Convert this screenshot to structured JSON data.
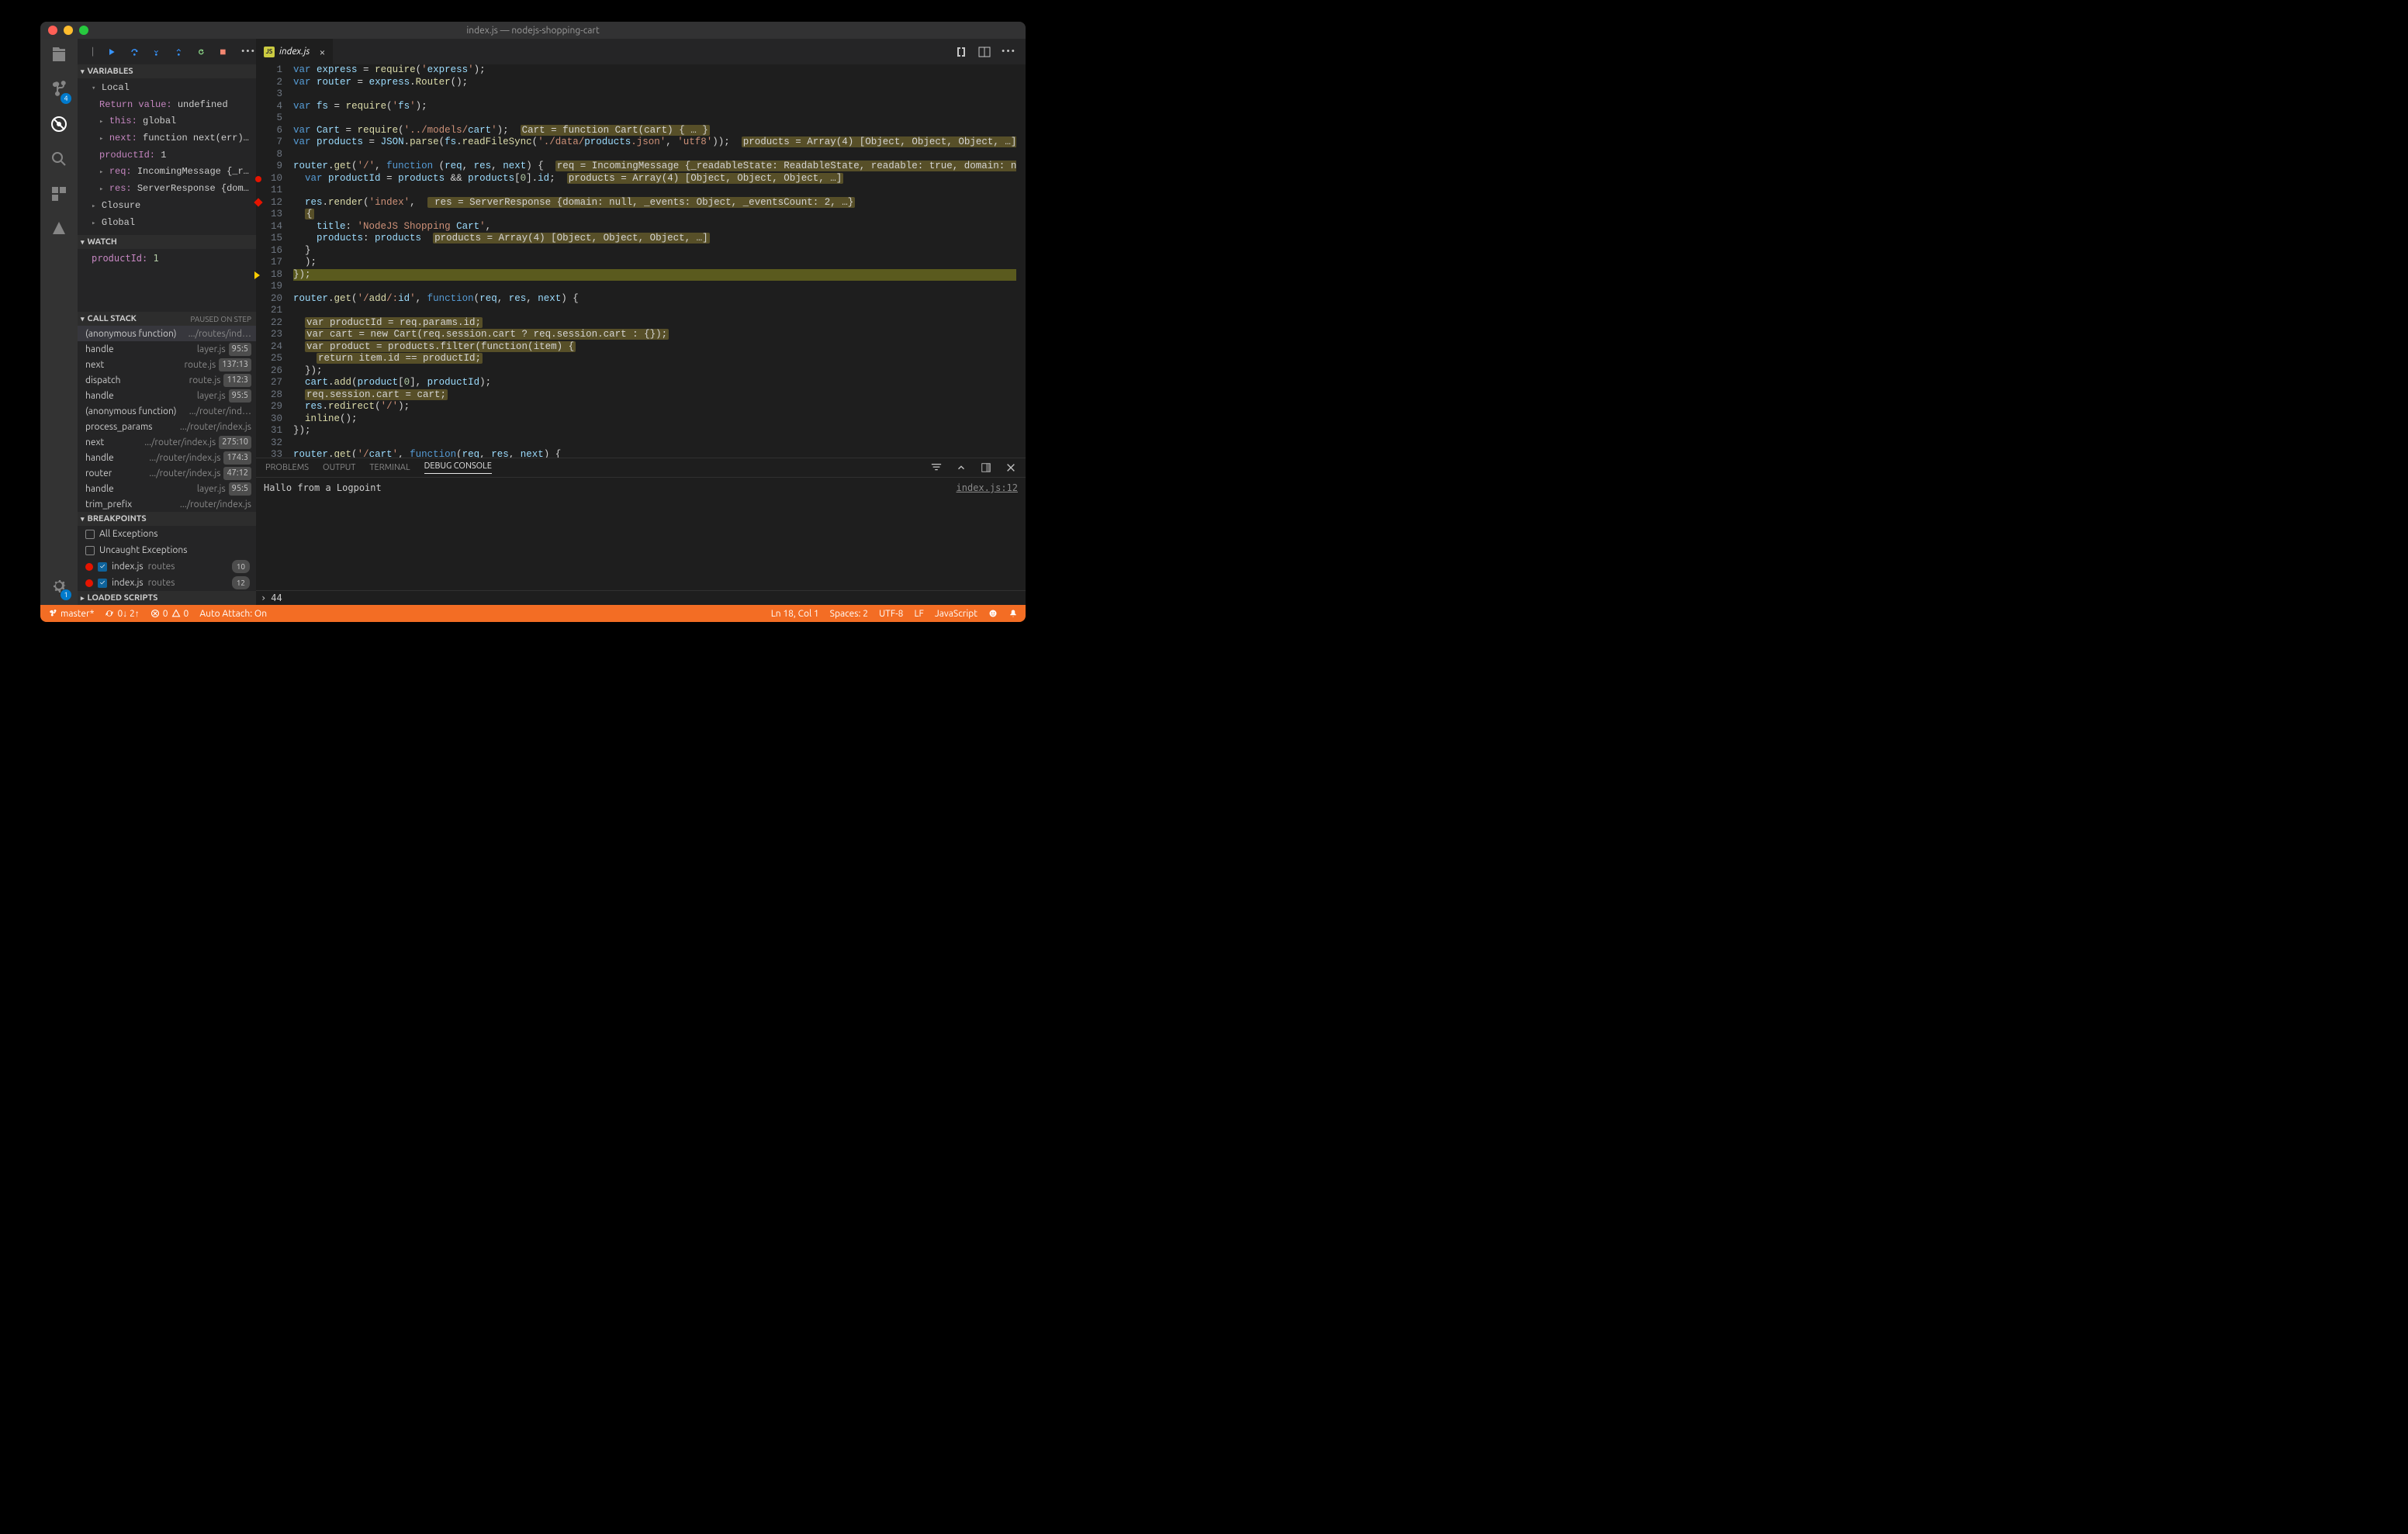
{
  "window_title": "index.js — nodejs-shopping-cart",
  "activity_badges": {
    "scm": "4",
    "settings": "1"
  },
  "debug_sections": {
    "variables": {
      "title": "VARIABLES",
      "scopes": {
        "local": "Local",
        "closure": "Closure",
        "global": "Global"
      },
      "locals": [
        {
          "name": "Return value:",
          "val": "undefined",
          "exp": false
        },
        {
          "name": "this:",
          "val": "global",
          "exp": true
        },
        {
          "name": "next:",
          "val": "function next(err) { … }",
          "exp": true
        },
        {
          "name": "productId:",
          "val": "1",
          "exp": false
        },
        {
          "name": "req:",
          "val": "IncomingMessage {_readableSt…",
          "exp": true
        },
        {
          "name": "res:",
          "val": "ServerResponse {domain: null…",
          "exp": true
        }
      ]
    },
    "watch": {
      "title": "WATCH",
      "items": [
        {
          "name": "productId:",
          "val": "1"
        }
      ]
    },
    "callstack": {
      "title": "CALL STACK",
      "status": "PAUSED ON STEP",
      "frames": [
        {
          "fn": "(anonymous function)",
          "src": ".../routes/ind…",
          "loc": ""
        },
        {
          "fn": "handle",
          "src": "layer.js",
          "loc": "95:5"
        },
        {
          "fn": "next",
          "src": "route.js",
          "loc": "137:13"
        },
        {
          "fn": "dispatch",
          "src": "route.js",
          "loc": "112:3"
        },
        {
          "fn": "handle",
          "src": "layer.js",
          "loc": "95:5"
        },
        {
          "fn": "(anonymous function)",
          "src": ".../router/ind…",
          "loc": ""
        },
        {
          "fn": "process_params",
          "src": ".../router/index.js",
          "loc": ""
        },
        {
          "fn": "next",
          "src": ".../router/index.js",
          "loc": "275:10"
        },
        {
          "fn": "handle",
          "src": ".../router/index.js",
          "loc": "174:3"
        },
        {
          "fn": "router",
          "src": ".../router/index.js",
          "loc": "47:12"
        },
        {
          "fn": "handle",
          "src": "layer.js",
          "loc": "95:5"
        },
        {
          "fn": "trim_prefix",
          "src": ".../router/index.js",
          "loc": ""
        }
      ]
    },
    "breakpoints": {
      "title": "BREAKPOINTS",
      "static": [
        {
          "label": "All Exceptions",
          "checked": false
        },
        {
          "label": "Uncaught Exceptions",
          "checked": false
        }
      ],
      "items": [
        {
          "file": "index.js",
          "dir": "routes",
          "line": "10",
          "checked": true,
          "bullet": true
        },
        {
          "file": "index.js",
          "dir": "routes",
          "line": "12",
          "checked": true,
          "bullet": true
        }
      ]
    },
    "loaded_scripts": {
      "title": "LOADED SCRIPTS"
    }
  },
  "tab": {
    "label": "index.js"
  },
  "code_lines": [
    "var express = require('express');",
    "var router = express.Router();",
    "",
    "var fs = require('fs');",
    "",
    "var Cart = require('../models/cart');  Cart = function Cart(cart) { … }",
    "var products = JSON.parse(fs.readFileSync('./data/products.json', 'utf8'));  products = Array(4) [Object, Object, Object, …]",
    "",
    "router.get('/', function (req, res, next) {  req = IncomingMessage {_readableState: ReadableState, readable: true, domain: null, …}, res = ServerRes",
    "  var productId = products && products[0].id;  products = Array(4) [Object, Object, Object, …]",
    "",
    "  res.render('index',   res = ServerResponse {domain: null, _events: Object, _eventsCount: 2, …}",
    "  {",
    "    title: 'NodeJS Shopping Cart',",
    "    products: products  products = Array(4) [Object, Object, Object, …]",
    "  }",
    "  );",
    "});",
    "",
    "router.get('/add/:id', function(req, res, next) {",
    "",
    "  var productId = req.params.id;",
    "  var cart = new Cart(req.session.cart ? req.session.cart : {});",
    "  var product = products.filter(function(item) {",
    "    return item.id == productId;",
    "  });",
    "  cart.add(product[0], productId);",
    "  req.session.cart = cart;",
    "  res.redirect('/');",
    "  inline();",
    "});",
    "",
    "router.get('/cart', function(req, res, next) {"
  ],
  "breakpoint_lines": {
    "red": [
      10
    ],
    "diamond": [
      12
    ],
    "current": 18
  },
  "panel": {
    "tabs": [
      "PROBLEMS",
      "OUTPUT",
      "TERMINAL",
      "DEBUG CONSOLE"
    ],
    "active": 3,
    "log": "Hallo from a Logpoint",
    "origin": "index.js:12",
    "repl_value": "44"
  },
  "status": {
    "branch": "master*",
    "sync": "0↓ 2↑",
    "errors": "0",
    "warnings": "0",
    "auto_attach": "Auto Attach: On",
    "cursor": "Ln 18, Col 1",
    "spaces": "Spaces: 2",
    "encoding": "UTF-8",
    "eol": "LF",
    "lang": "JavaScript"
  }
}
